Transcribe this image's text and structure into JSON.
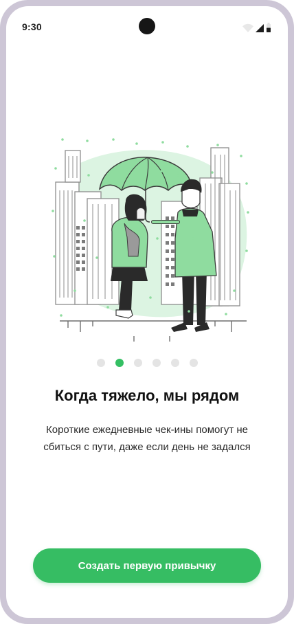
{
  "status_bar": {
    "time": "9:30",
    "icons": [
      "wifi-icon",
      "cellular-signal-icon",
      "battery-icon"
    ]
  },
  "illustration": {
    "subject": "couple-under-umbrella-in-rain-icon"
  },
  "pager": {
    "count": 6,
    "active_index": 1
  },
  "onboarding": {
    "title": "Когда тяжело, мы рядом",
    "subtitle": "Короткие ежедневные чек-ины помогут не сбиться с пути, даже если день не задался"
  },
  "cta": {
    "label": "Создать первую привычку"
  },
  "colors": {
    "accent": "#36bd63",
    "dot_inactive": "#e4e4e4",
    "frame": "#cdc6d6",
    "illustration_light_green": "#d7f3df",
    "illustration_green": "#8ee0a1"
  }
}
